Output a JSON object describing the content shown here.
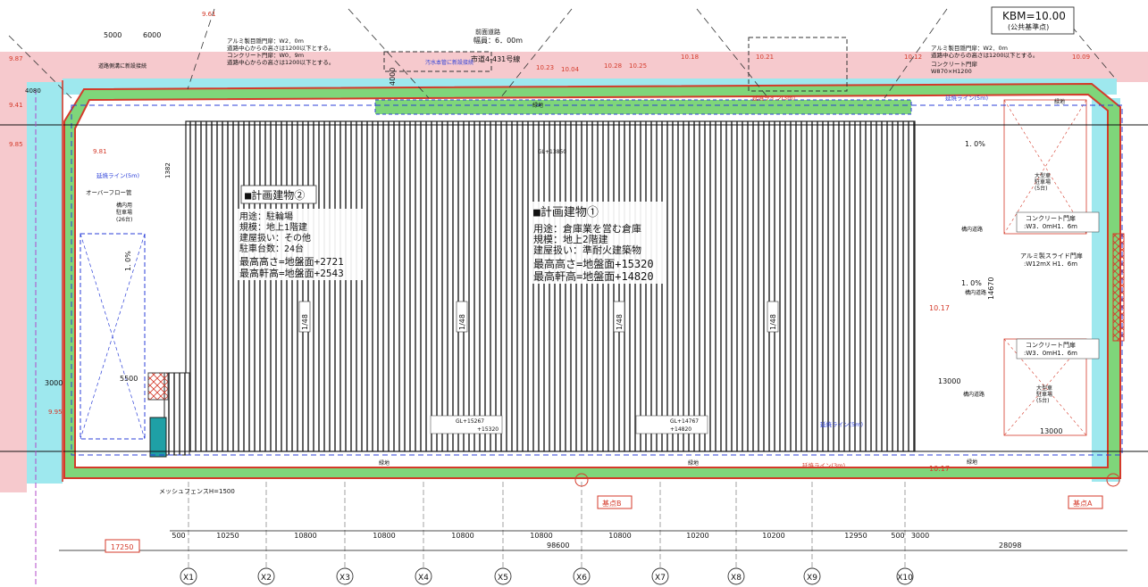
{
  "kbm": {
    "line1": "KBM=10.00",
    "line2": "(公共基準点)"
  },
  "road_front": {
    "title": "前面道路",
    "width": "幅員：6．00m",
    "road_no": "市道4-431号線",
    "drain": "汚水本管に新設接続",
    "drain2": "道路側溝に新設接続"
  },
  "wall_notes": {
    "left_1": "アルミ製目隠門扉：W2．0m",
    "left_2": "道路中心からの高さは1200以下とする。",
    "left_3": "コンクリート門扉：W0．9m",
    "left_4": "道路中心からの高さは1200以下とする。",
    "right_1": "アルミ製目隠門扉：W2．0m",
    "right_2": "道路中心からの高さは1200以下とする。",
    "right_3": "コンクリート門扉",
    "right_4": "W870×H1200"
  },
  "building2": {
    "title": "■計画建物②",
    "lines": [
      "用途：駐輪場",
      "規模：地上1階建",
      "建屋扱い：その他",
      "駐車台数：24台",
      "最高高さ=地盤面+2721",
      "最高軒高=地盤面+2543"
    ]
  },
  "building1": {
    "title": "■計画建物①",
    "lines": [
      "用途：倉庫業を営む倉庫",
      "規模：地上2階建",
      "建屋扱い：準耐火建築物",
      "最高高さ=地盤面+15320",
      "最高軒高=地盤面+14820"
    ]
  },
  "roof_labels": [
    "1/48",
    "1/48",
    "1/48",
    "1/48"
  ],
  "gl_labels": {
    "top": "GL+13850",
    "bottom_left_1": "GL+15267",
    "bottom_left_2": "+15320",
    "bottom_right_1": "GL+14767",
    "bottom_right_2": "+14820"
  },
  "right_area": {
    "slope_top": "1. 0%",
    "slope_mid": "1. 0%",
    "passage_1": "構内道路",
    "passage_2": "構内道路",
    "passage_3": "構内道路",
    "parking_top": "大型車",
    "parking_top_2": "駐車場",
    "parking_top_3": "(5台)",
    "gate_1": "コンクリート門扉",
    "gate_1b": ":W3．0mH1．6m",
    "gate_2": "アルミ製スライド門扉",
    "gate_2b": ":W12mX H1．6m",
    "gate_3": "コンクリート門扉",
    "gate_3b": ":W3．0mH1．6m",
    "parking_bot": "大型車",
    "parking_bot_2": "駐車場",
    "parking_bot_3": "(5台)",
    "dim_13000a": "13000",
    "dim_13000b": "13000",
    "dim_14670": "14670",
    "level_1017a": "10.17",
    "level_1017b": "10.17"
  },
  "left_area": {
    "overflow": "オーバーフロー管",
    "parking": "構内用",
    "parking2": "駐車場",
    "parking3": "(26台)",
    "slope": "1. 0%",
    "dim_5500": "5500",
    "dim_5000a": "5000",
    "dim_6000": "6000",
    "dim_4000": "4000",
    "mesh_fence": "メッシュフェンスH=1500",
    "dim_3000": "3000",
    "dim_1382": "1382"
  },
  "green_labels": [
    "緑地",
    "緑地",
    "緑地",
    "緑地",
    "緑地"
  ],
  "bottom_dims": [
    "500",
    "10250",
    "10800",
    "10800",
    "10800",
    "10800",
    "10800",
    "10200",
    "10200",
    "12950",
    "500",
    "3000"
  ],
  "overall_dims": {
    "main": "98600",
    "right": "28098",
    "left": "17250"
  },
  "grid_labels": [
    "X1",
    "X2",
    "X3",
    "X4",
    "X5",
    "X6",
    "X7",
    "X8",
    "X9",
    "X10"
  ],
  "points": {
    "b": "基点B",
    "a": "基点A"
  },
  "road_levels": [
    "10.23",
    "10.04",
    "10.18",
    "10.21",
    "10.12",
    "10.09",
    "9.61",
    "10.28",
    "10.25"
  ],
  "left_levels": [
    "9.87",
    "9.85",
    "9.81",
    "9.41",
    "9.95",
    "4080"
  ],
  "boundary_lines": [
    "延焼ライン(5m)",
    "延焼ライン(3m)",
    "延焼ライン(5m)",
    "延焼ライン(3m)",
    "延焼ライン(5m)"
  ],
  "colors": {
    "green": "#7fd67a",
    "pink": "#f6c9cd",
    "cyan": "#9ee8ee",
    "red": "#d43a2a",
    "blue": "#2b3fd8",
    "hatch": "#555555"
  }
}
